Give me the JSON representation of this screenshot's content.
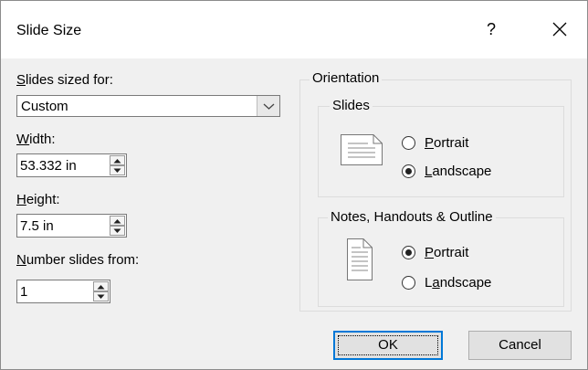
{
  "window": {
    "title": "Slide Size",
    "help_label": "?",
    "close_icon": "close-icon"
  },
  "sized_for": {
    "label_key": "S",
    "label_rest": "lides sized for:",
    "selected": "Custom"
  },
  "width": {
    "label_key": "W",
    "label_rest": "idth:",
    "value": "53.332 in"
  },
  "height": {
    "label_key": "H",
    "label_rest": "eight:",
    "value": "7.5 in"
  },
  "number_from": {
    "label_key": "N",
    "label_rest": "umber slides from:",
    "value": "1"
  },
  "orientation": {
    "title": "Orientation",
    "slides": {
      "title": "Slides",
      "portrait_key": "P",
      "portrait_rest": "ortrait",
      "landscape_key": "L",
      "landscape_rest": "andscape",
      "selected": "landscape"
    },
    "notes": {
      "title": "Notes, Handouts & Outline",
      "portrait_key": "P",
      "portrait_rest": "ortrait",
      "landscape_pre": "L",
      "landscape_key": "a",
      "landscape_rest": "ndscape",
      "selected": "portrait"
    }
  },
  "buttons": {
    "ok": "OK",
    "cancel": "Cancel"
  }
}
